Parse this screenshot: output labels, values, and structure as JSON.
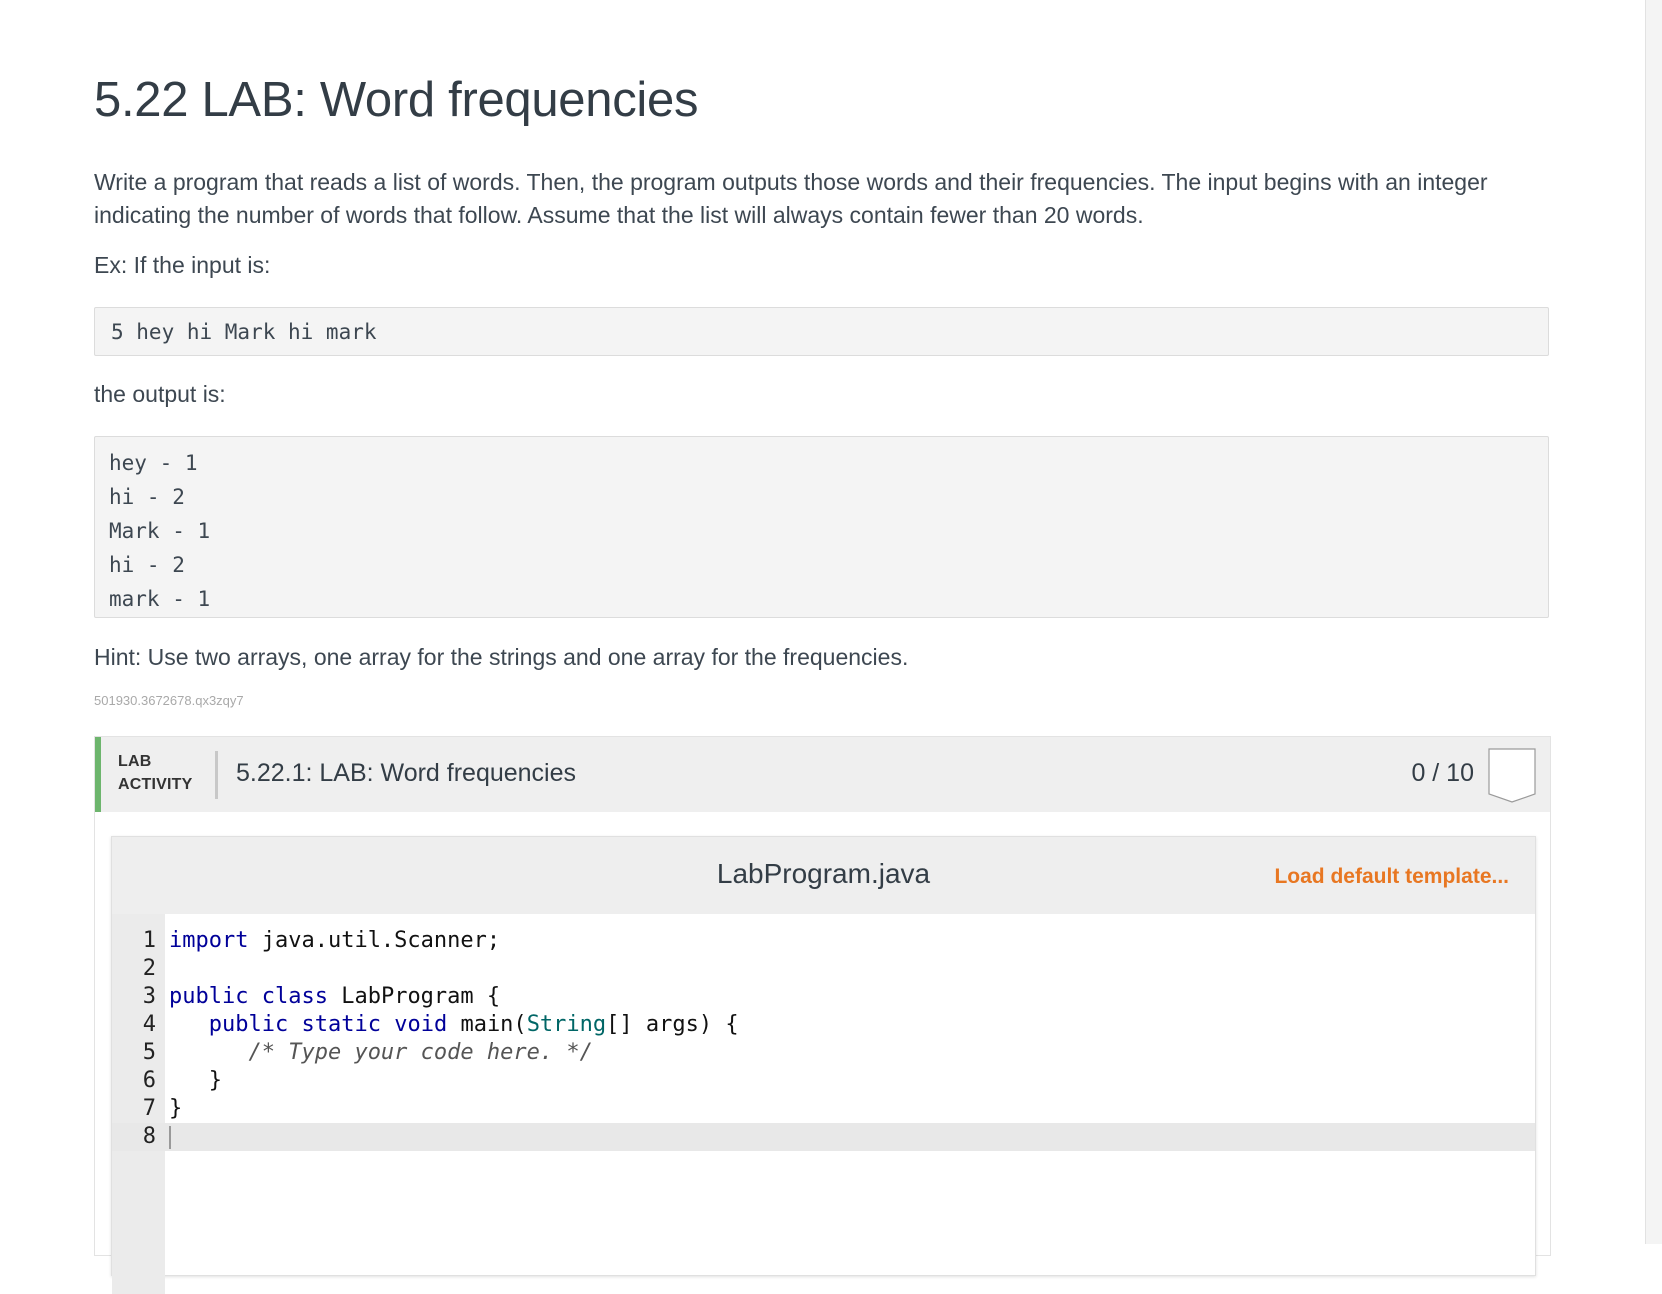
{
  "page": {
    "title": "5.22 LAB: Word frequencies",
    "description": "Write a program that reads a list of words. Then, the program outputs those words and their frequencies. The input begins with an integer indicating the number of words that follow. Assume that the list will always contain fewer than 20 words.",
    "example_intro": "Ex: If the input is:",
    "example_input": "5 hey hi Mark hi mark",
    "output_intro": "the output is:",
    "example_output": [
      "hey - 1",
      "hi - 2",
      "Mark - 1",
      "hi - 2",
      "mark - 1"
    ],
    "hint": "Hint: Use two arrays, one array for the strings and one array for the frequencies.",
    "ref_id": "501930.3672678.qx3zqy7"
  },
  "lab": {
    "type_line1": "LAB",
    "type_line2": "ACTIVITY",
    "title": "5.22.1: LAB: Word frequencies",
    "score": "0 / 10",
    "accent_color": "#6db56d"
  },
  "editor": {
    "file_name": "LabProgram.java",
    "load_template": "Load default template...",
    "load_template_color": "#e87722",
    "lines": [
      {
        "n": "1",
        "parts": [
          {
            "t": "import",
            "c": "kw"
          },
          {
            "t": " java.util.Scanner;",
            "c": ""
          }
        ]
      },
      {
        "n": "2",
        "parts": []
      },
      {
        "n": "3",
        "parts": [
          {
            "t": "public",
            "c": "kw"
          },
          {
            "t": " ",
            "c": ""
          },
          {
            "t": "class",
            "c": "kw"
          },
          {
            "t": " LabProgram {",
            "c": ""
          }
        ]
      },
      {
        "n": "4",
        "parts": [
          {
            "t": "   ",
            "c": ""
          },
          {
            "t": "public",
            "c": "kw"
          },
          {
            "t": " ",
            "c": ""
          },
          {
            "t": "static",
            "c": "kw"
          },
          {
            "t": " ",
            "c": ""
          },
          {
            "t": "void",
            "c": "kw"
          },
          {
            "t": " main(",
            "c": ""
          },
          {
            "t": "String",
            "c": "ty"
          },
          {
            "t": "[] args) {",
            "c": ""
          }
        ]
      },
      {
        "n": "5",
        "parts": [
          {
            "t": "      ",
            "c": ""
          },
          {
            "t": "/* Type your code here. */",
            "c": "cm"
          }
        ]
      },
      {
        "n": "6",
        "parts": [
          {
            "t": "   }",
            "c": ""
          }
        ]
      },
      {
        "n": "7",
        "parts": [
          {
            "t": "}",
            "c": ""
          }
        ]
      },
      {
        "n": "8",
        "parts": []
      }
    ]
  }
}
